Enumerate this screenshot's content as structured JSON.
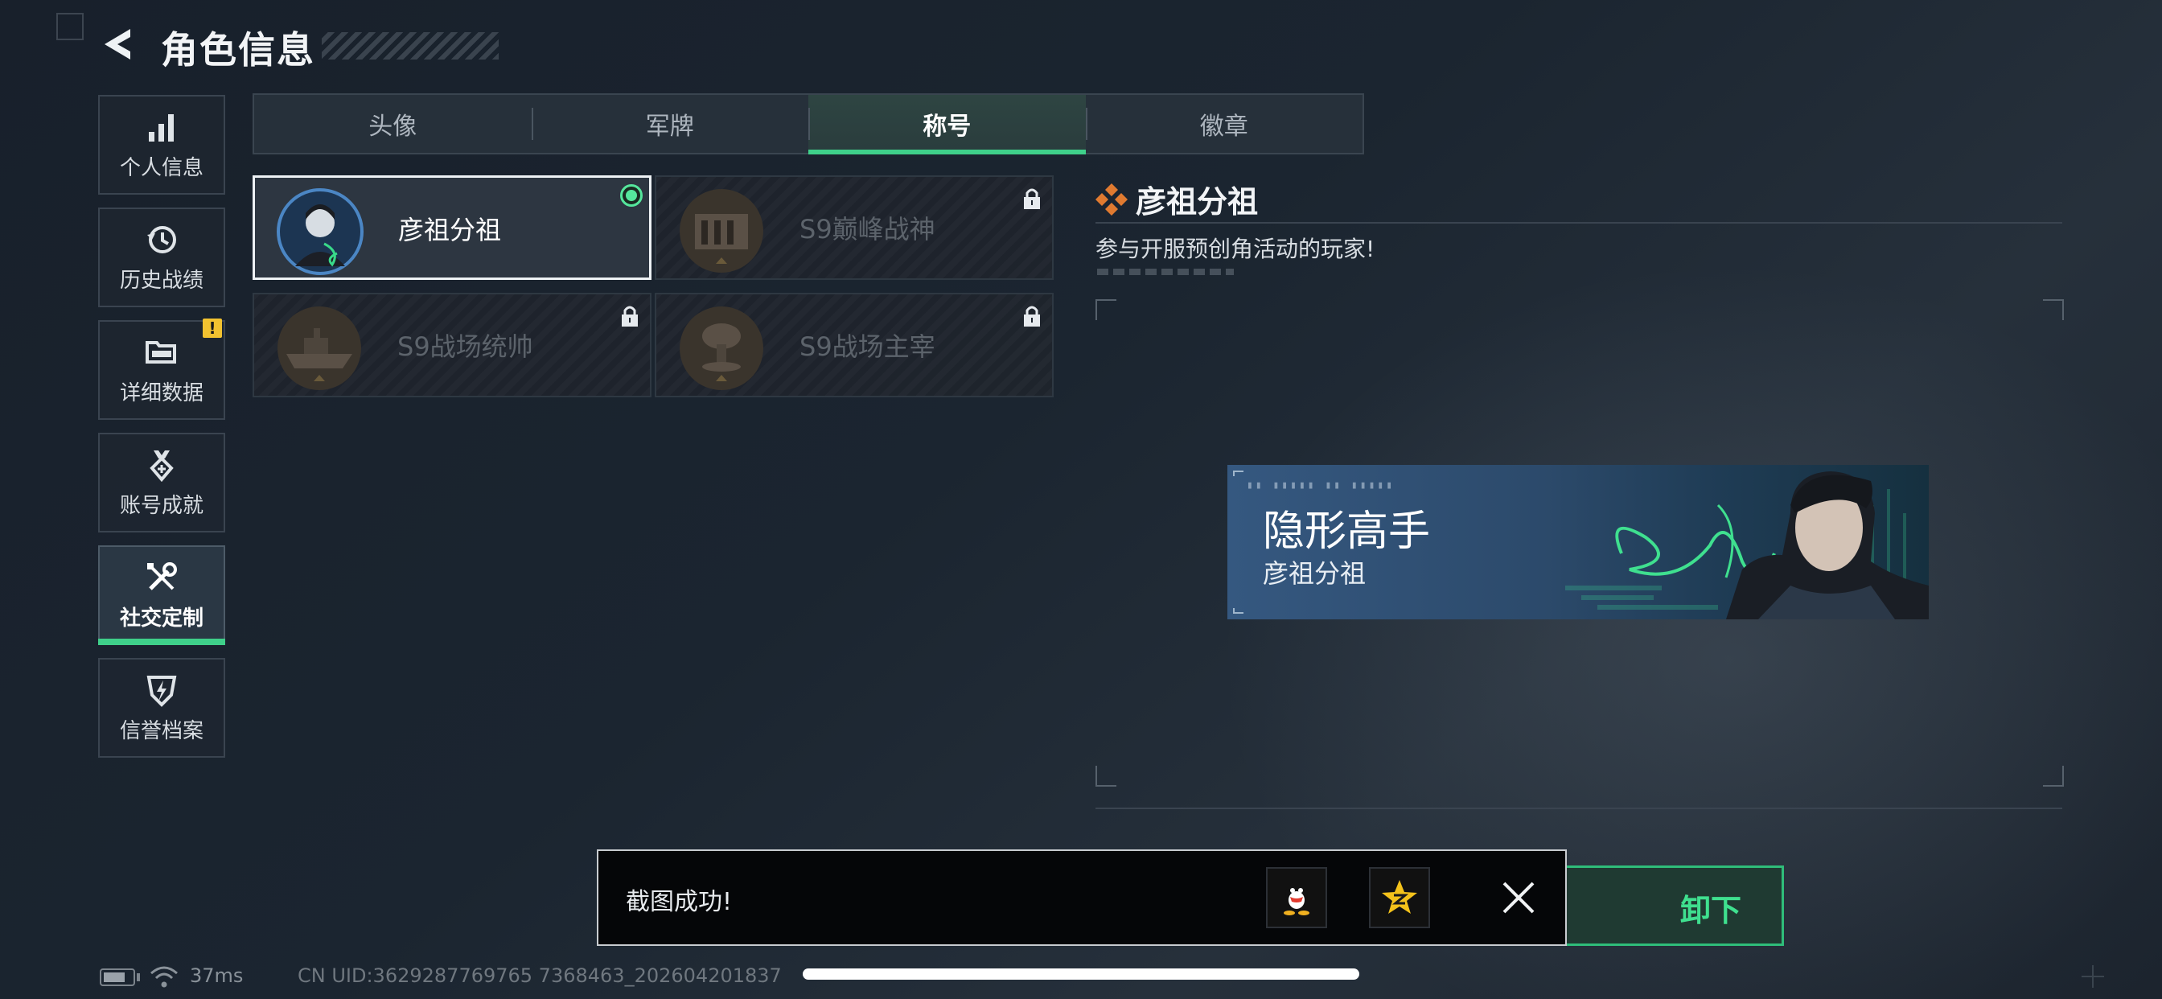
{
  "header": {
    "title": "角色信息"
  },
  "sidebar": {
    "items": [
      {
        "label": "个人信息",
        "icon": "bar-chart-icon"
      },
      {
        "label": "历史战绩",
        "icon": "history-clock-icon"
      },
      {
        "label": "详细数据",
        "icon": "folder-icon",
        "badge": "!"
      },
      {
        "label": "账号成就",
        "icon": "medal-icon"
      },
      {
        "label": "社交定制",
        "icon": "wrench-screwdriver-icon",
        "active": true
      },
      {
        "label": "信誉档案",
        "icon": "shield-lightning-icon"
      }
    ]
  },
  "tabs": [
    {
      "label": "头像"
    },
    {
      "label": "军牌"
    },
    {
      "label": "称号",
      "active": true
    },
    {
      "label": "徽章"
    }
  ],
  "titles": [
    {
      "name": "彦祖分祖",
      "selected": true,
      "locked": false
    },
    {
      "name": "S9巅峰战神",
      "selected": false,
      "locked": true
    },
    {
      "name": "S9战场统帅",
      "selected": false,
      "locked": true
    },
    {
      "name": "S9战场主宰",
      "selected": false,
      "locked": true
    }
  ],
  "detail": {
    "title": "彦祖分祖",
    "description": "参与开服预创角活动的玩家!"
  },
  "banner": {
    "main_text": "隐形高手",
    "sub_text": "彦祖分祖"
  },
  "toast": {
    "text": "截图成功!",
    "share_icons": [
      "qq-penguin-icon",
      "qzone-star-icon"
    ],
    "close_icon": "close-icon"
  },
  "confirm_button": {
    "visible_label": "卸下"
  },
  "status_bar": {
    "ping": "37ms",
    "uid": "CN UID:3629287769765 7368463_202604201837"
  },
  "colors": {
    "accent_green": "#3fd08a",
    "background": "#1b2530",
    "banner_blue": "#2c4a6b",
    "warning_yellow": "#f2c230"
  }
}
